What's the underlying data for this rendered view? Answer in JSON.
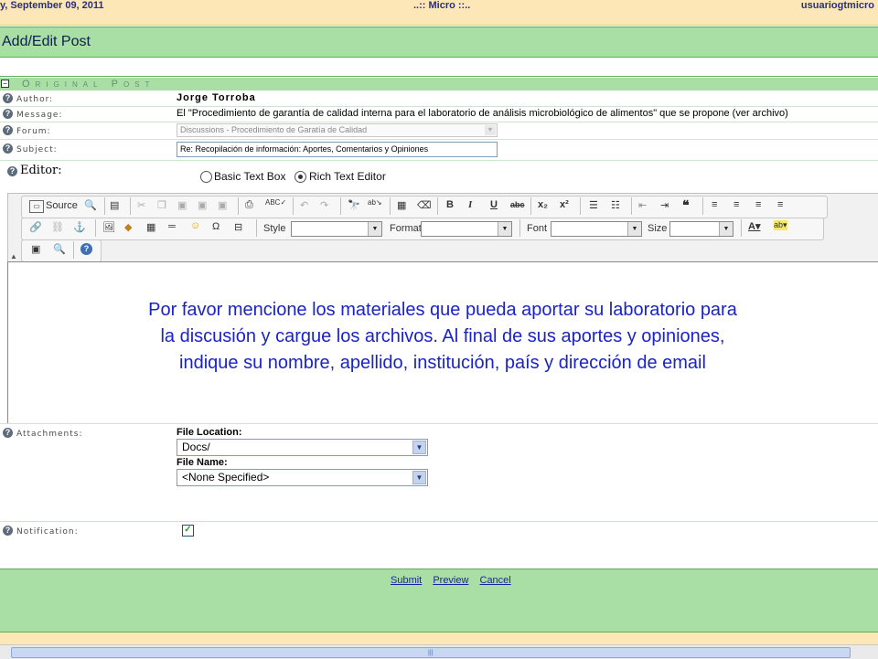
{
  "header": {
    "date": "y, September 09, 2011",
    "site": "..:: Micro ::..",
    "user": "usuariogtmicro"
  },
  "page_title": "Add/Edit Post",
  "section_title": "Original Post",
  "form": {
    "author_label": "Author:",
    "author_value": "Jorge Torroba",
    "message_label": "Message:",
    "message_value": "El \"Procedimiento de garantía de calidad interna para el laboratorio de análisis microbiológico de alimentos\" que se propone (ver archivo)",
    "forum_label": "Forum:",
    "forum_value": "Discussions - Procedimiento de Garatía de Calidad",
    "subject_label": "Subject:",
    "subject_value": "Re: Recopilación de información: Aportes, Comentarios y Opiniones"
  },
  "editor": {
    "label": "Editor:",
    "option_basic": "Basic Text Box",
    "option_rich": "Rich Text Editor",
    "selected": "Rich Text Editor",
    "toolbar": {
      "source": "Source",
      "style": "Style",
      "format": "Format",
      "font": "Font",
      "size": "Size"
    },
    "content_lines": [
      "Por favor mencione los materiales que pueda aportar su laboratorio para",
      "la discusión y cargue los archivos. Al final de sus aportes y opiniones,",
      "indique su nombre, apellido, institución, país y dirección de email"
    ]
  },
  "attachments": {
    "label": "Attachments:",
    "file_location_label": "File Location:",
    "file_location_value": "Docs/",
    "file_name_label": "File Name:",
    "file_name_value": "<None Specified>"
  },
  "notification": {
    "label": "Notification:",
    "checked": true
  },
  "footer": {
    "submit": "Submit",
    "preview": "Preview",
    "cancel": "Cancel"
  },
  "colors": {
    "green": "#a9dea5",
    "orange": "#fde7b6",
    "editor_text": "#1a23c7",
    "link": "#1d1fa6"
  }
}
